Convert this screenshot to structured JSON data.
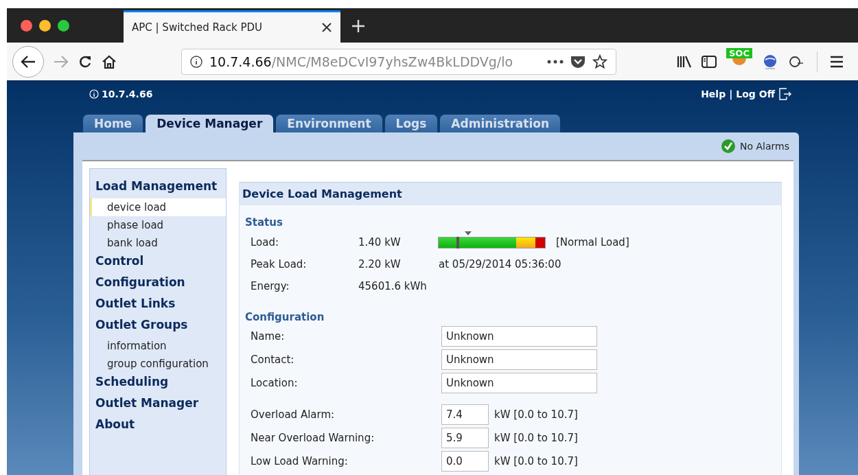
{
  "browser": {
    "tab_title": "APC | Switched Rack PDU",
    "url_host": "10.7.4.66",
    "url_path": "/NMC/M8eDCvI97yhsZw4BkLDDVg/lo",
    "extension_badge": "SOC"
  },
  "header": {
    "address": "10.7.4.66",
    "links": [
      "Help",
      "|",
      "Log Off"
    ]
  },
  "tabs": [
    {
      "label": "Home",
      "selected": false
    },
    {
      "label": "Device Manager",
      "selected": true
    },
    {
      "label": "Environment",
      "selected": false
    },
    {
      "label": "Logs",
      "selected": false
    },
    {
      "label": "Administration",
      "selected": false
    }
  ],
  "alarm_status": "No Alarms",
  "sidebar": {
    "items": [
      {
        "label": "Load Management",
        "children": [
          {
            "label": "device load",
            "selected": true
          },
          {
            "label": "phase load",
            "selected": false
          },
          {
            "label": "bank load",
            "selected": false
          }
        ]
      },
      {
        "label": "Control"
      },
      {
        "label": "Configuration"
      },
      {
        "label": "Outlet Links"
      },
      {
        "label": "Outlet Groups",
        "children": [
          {
            "label": "information",
            "selected": false
          },
          {
            "label": "group configuration",
            "selected": false
          }
        ]
      },
      {
        "label": "Scheduling"
      },
      {
        "label": "Outlet Manager"
      },
      {
        "label": "About"
      }
    ]
  },
  "panel": {
    "title": "Device Load Management",
    "status_heading": "Status",
    "status": [
      {
        "kind": "meter",
        "label": "Load:",
        "value": "1.40 kW",
        "level": 0.18,
        "note": "[Normal Load]"
      },
      {
        "kind": "text",
        "label": "Peak Load:",
        "value": "2.20 kW",
        "note": "at 05/29/2014 05:36:00"
      },
      {
        "kind": "text",
        "label": "Energy:",
        "value": "45601.6 kWh"
      }
    ],
    "config_heading": "Configuration",
    "config": [
      {
        "kind": "wide",
        "label": "Name:",
        "value": "Unknown"
      },
      {
        "kind": "wide",
        "label": "Contact:",
        "value": "Unknown"
      },
      {
        "kind": "wide",
        "label": "Location:",
        "value": "Unknown"
      },
      {
        "kind": "narrow",
        "label": "Overload Alarm:",
        "value": "7.4",
        "unit": "kW [0.0 to 10.7]"
      },
      {
        "kind": "narrow",
        "label": "Near Overload Warning:",
        "value": "5.9",
        "unit": "kW [0.0 to 10.7]"
      },
      {
        "kind": "narrow",
        "label": "Low Load Warning:",
        "value": "0.0",
        "unit": "kW [0.0 to 10.7]"
      }
    ]
  }
}
